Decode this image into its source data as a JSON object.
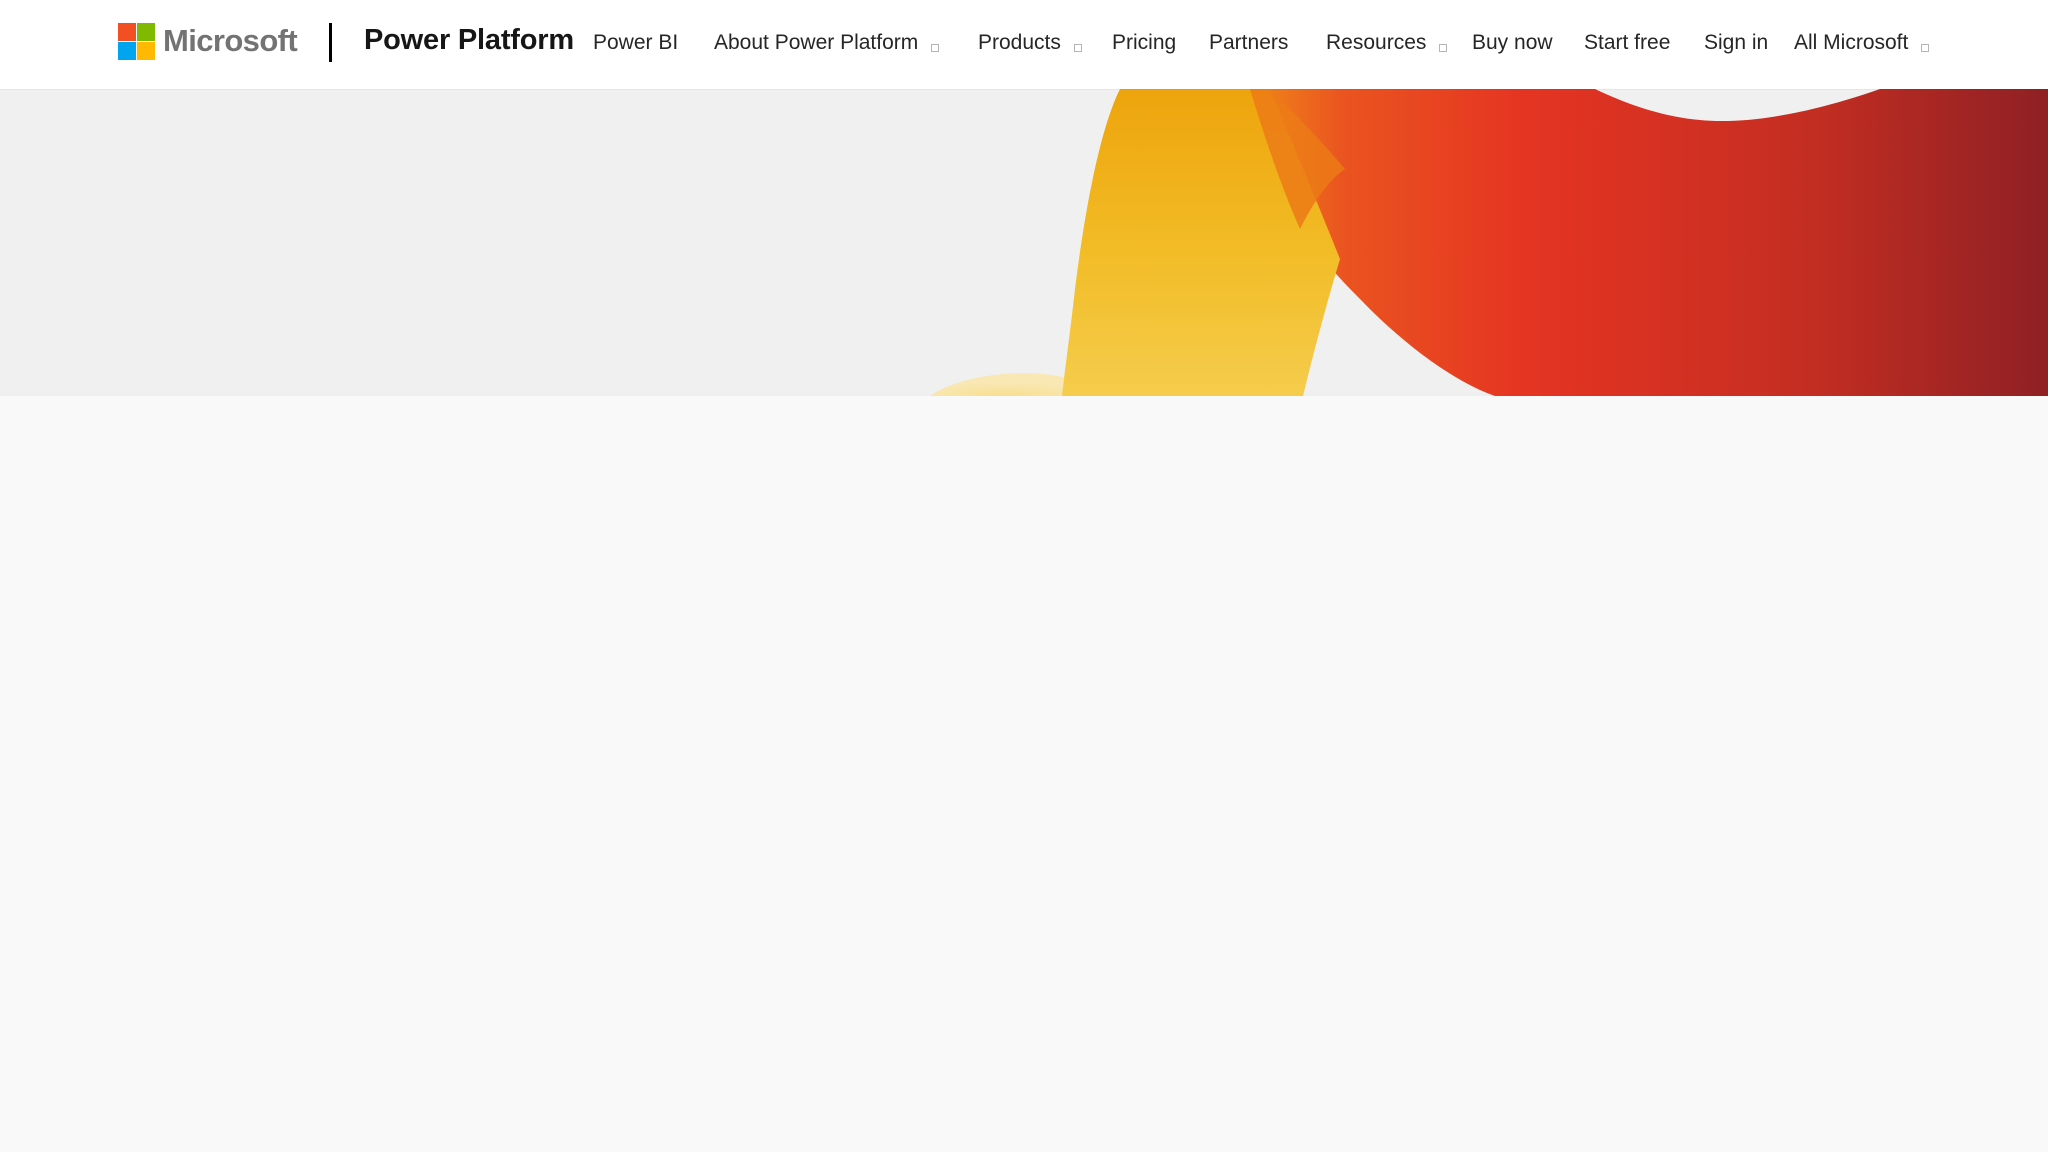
{
  "header": {
    "brand": {
      "wordmark": "Microsoft",
      "logo_colors": [
        "#f25022",
        "#7fba00",
        "#00a4ef",
        "#ffb900"
      ],
      "logo_icon": "microsoft-logo-icon"
    },
    "product_name": "Power Platform",
    "nav": [
      {
        "label": "Power BI",
        "has_dropdown": false
      },
      {
        "label": "About Power Platform",
        "has_dropdown": true
      },
      {
        "label": "Products",
        "has_dropdown": true
      },
      {
        "label": "Pricing",
        "has_dropdown": false
      },
      {
        "label": "Partners",
        "has_dropdown": false
      },
      {
        "label": "Resources",
        "has_dropdown": true
      },
      {
        "label": "Buy now",
        "has_dropdown": false
      },
      {
        "label": "Start free",
        "has_dropdown": false
      },
      {
        "label": "Sign in",
        "has_dropdown": false
      },
      {
        "label": "All Microsoft",
        "has_dropdown": true
      }
    ],
    "dropdown_icon": "chevron-down-icon"
  },
  "hero": {
    "colors": {
      "background": "#f0f0f0",
      "yellow": "#f2b90f",
      "orange_red": "#e83a20",
      "dark_red": "#9b2020"
    }
  }
}
